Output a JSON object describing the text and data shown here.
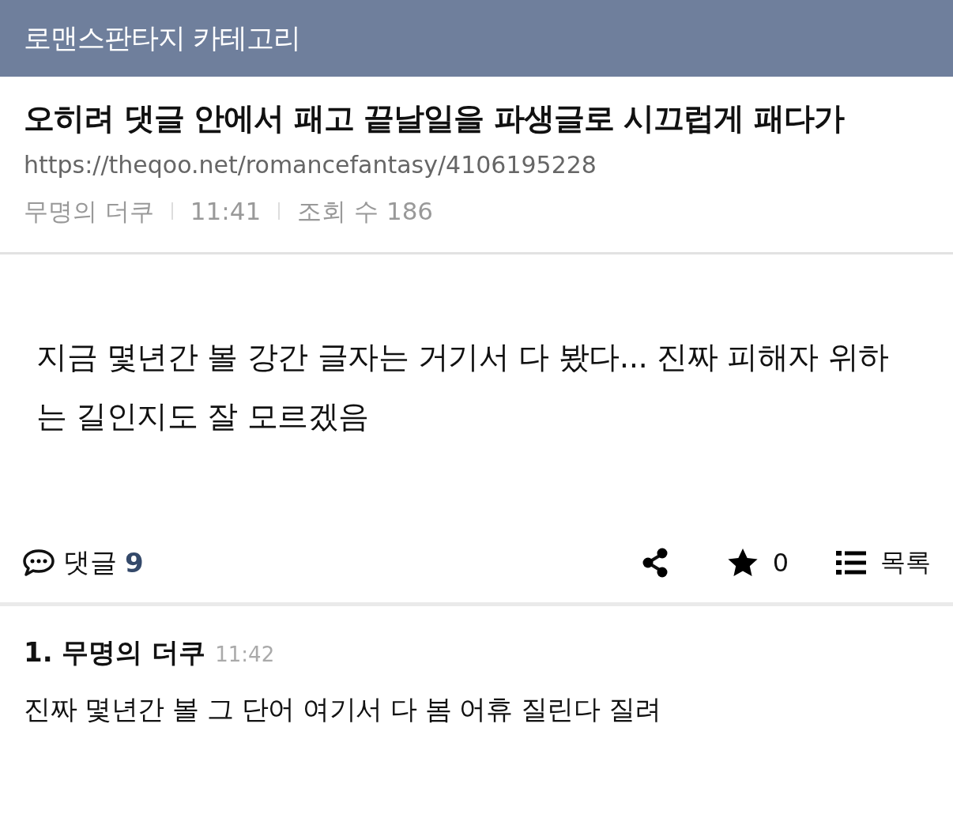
{
  "category_bar": {
    "title": "로맨스판타지 카테고리"
  },
  "post": {
    "title": "오히려 댓글 안에서 패고 끝날일을 파생글로 시끄럽게 패다가",
    "url": "https://theqoo.net/romancefantasy/4106195228",
    "author": "무명의 더쿠",
    "time": "11:41",
    "views": "조회 수 186",
    "body": "지금 몇년간 볼 강간 글자는 거기서 다 봤다... 진짜 피해자 위하는 길인지도 잘 모르겠음"
  },
  "actions": {
    "comments_label": "댓글",
    "comments_count": "9",
    "stars_count": "0",
    "list_label": "목록"
  },
  "comments": [
    {
      "number": "1.",
      "author": "무명의 더쿠",
      "time": "11:42",
      "text": "진짜 몇년간 볼 그 단어 여기서 다 봄 어휴 질린다 질려"
    }
  ]
}
